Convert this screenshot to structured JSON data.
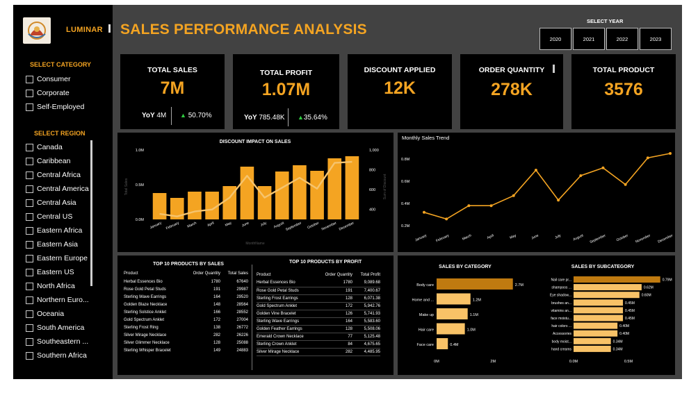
{
  "brand": {
    "name": "LUMINAR"
  },
  "header": {
    "title": "SALES PERFORMANCE ANALYSIS"
  },
  "year_selector": {
    "label": "SELECT YEAR",
    "options": [
      "2020",
      "2021",
      "2022",
      "2023"
    ]
  },
  "sidebar": {
    "category_title": "SELECT CATEGORY",
    "categories": [
      "Consumer",
      "Corporate",
      "Self-Employed"
    ],
    "region_title": "SELECT REGION",
    "regions": [
      "Canada",
      "Caribbean",
      "Central Africa",
      "Central America",
      "Central Asia",
      "Central US",
      "Eastern Africa",
      "Eastern Asia",
      "Eastern Europe",
      "Eastern US",
      "North Africa",
      "Northern Euro...",
      "Oceania",
      "South America",
      "Southeastern ...",
      "Southern Africa"
    ]
  },
  "kpis": {
    "total_sales": {
      "label": "TOTAL SALES",
      "value": "7M",
      "yoy_label": "YoY",
      "yoy_value": "4M",
      "yoy_pct": "50.70%"
    },
    "total_profit": {
      "label": "TOTAL PROFIT",
      "value": "1.07M",
      "yoy_label": "YoY",
      "yoy_value": "785.48K",
      "yoy_pct": "35.64%"
    },
    "discount": {
      "label": "DISCOUNT APPLIED",
      "value": "12K"
    },
    "order_qty": {
      "label": "ORDER QUANTITY",
      "value": "278K"
    },
    "total_product": {
      "label": "TOTAL PRODUCT",
      "value": "3576"
    }
  },
  "chart_data": [
    {
      "type": "bar",
      "title": "DISCOUNT IMPACT ON SALES",
      "xlabel": "MonthName",
      "ylabel": "Total Sales",
      "y2label": "Sum of Discount",
      "categories": [
        "January",
        "February",
        "March",
        "April",
        "May",
        "June",
        "July",
        "August",
        "September",
        "October",
        "November",
        "December"
      ],
      "ylim": [
        0,
        1000000
      ],
      "yticks": [
        "1.0M",
        "0.5M",
        "0.0M"
      ],
      "y2lim": [
        300,
        1000
      ],
      "y2ticks": [
        "1,000",
        "800",
        "600",
        "400"
      ],
      "series": [
        {
          "values": [
            380000,
            310000,
            400000,
            400000,
            480000,
            760000,
            480000,
            690000,
            780000,
            700000,
            880000,
            910000
          ]
        },
        {
          "values": [
            356,
            330,
            380,
            400,
            520,
            740,
            520,
            620,
            720,
            610,
            870,
            880
          ]
        }
      ]
    },
    {
      "type": "line",
      "title": "Monthly Sales Trend",
      "categories": [
        "January",
        "February",
        "March",
        "April",
        "May",
        "June",
        "July",
        "August",
        "September",
        "October",
        "November",
        "December"
      ],
      "ylim": [
        150000,
        900000
      ],
      "yticks": [
        "0.8M",
        "0.6M",
        "0.4M",
        "0.2M"
      ],
      "values": [
        320000,
        260000,
        380000,
        380000,
        470000,
        700000,
        430000,
        650000,
        720000,
        570000,
        810000,
        850000
      ]
    },
    {
      "type": "bar",
      "title": "SALES BY CATEGORY",
      "categories": [
        "Body care",
        "Home and ...",
        "Make up",
        "Hair care",
        "Face care"
      ],
      "values": [
        2.7,
        1.2,
        1.1,
        1.0,
        0.4
      ],
      "value_labels": [
        "2.7M",
        "1.2M",
        "1.1M",
        "1.0M",
        "0.4M"
      ],
      "xticks": [
        "0M",
        "2M"
      ],
      "xlim": [
        0,
        3.2
      ]
    },
    {
      "type": "bar",
      "title": "SALES BY SUBCATEGORY",
      "categories": [
        "Nail care pr...",
        "shampoos ...",
        "Eye shadow...",
        "brushes an...",
        "vitamins an...",
        "face moistu...",
        "hair colors ...",
        "Accessories",
        "body moist...",
        "hand creams"
      ],
      "values": [
        0.79,
        0.62,
        0.6,
        0.45,
        0.45,
        0.45,
        0.4,
        0.4,
        0.34,
        0.34
      ],
      "value_labels": [
        "0.79M",
        "0.62M",
        "0.60M",
        "0.45M",
        "0.45M",
        "0.45M",
        "0.40M",
        "0.40M",
        "0.34M",
        "0.34M"
      ],
      "xticks": [
        "0.0M",
        "0.5M"
      ],
      "xlim": [
        0,
        0.95
      ]
    }
  ],
  "top_sales": {
    "title": "TOP 10 PRODUCTS BY SALES",
    "headers": [
      "Product",
      "Order Quantity",
      "Total Sales"
    ],
    "rows": [
      [
        "Herbal Essences Bio",
        "1780",
        "67640"
      ],
      [
        "Rose Gold Petal Studs",
        "191",
        "29987"
      ],
      [
        "Sterling Wave Earrings",
        "164",
        "29520"
      ],
      [
        "Golden Blaze Necklace",
        "148",
        "28564"
      ],
      [
        "Sterling Solstice Anklet",
        "166",
        "28552"
      ],
      [
        "Gold Spectrum Anklet",
        "172",
        "27004"
      ],
      [
        "Sterling Frost Ring",
        "138",
        "26772"
      ],
      [
        "Silver Mirage Necklace",
        "282",
        "26226"
      ],
      [
        "Silver Glimmer Necklace",
        "128",
        "25088"
      ],
      [
        "Sterling Whisper Bracelet",
        "149",
        "24883"
      ]
    ]
  },
  "top_profit": {
    "title": "TOP 10 PRODUCTS BY PROFIT",
    "headers": [
      "Product",
      "Order Quantity",
      "Total Profit"
    ],
    "rows": [
      [
        "Herbal Essences Bio",
        "1780",
        "9,089.68"
      ],
      [
        "Rose Gold Petal Studs",
        "191",
        "7,400.67"
      ],
      [
        "Sterling Frost Earrings",
        "128",
        "6,071.38"
      ],
      [
        "Gold Spectrum Anklet",
        "172",
        "5,942.76"
      ],
      [
        "Golden Vine Bracelet",
        "126",
        "5,741.93"
      ],
      [
        "Sterling Wave Earrings",
        "164",
        "5,583.60"
      ],
      [
        "Golden Feather Earrings",
        "128",
        "5,508.06"
      ],
      [
        "Emerald Crown Necklace",
        "77",
        "5,125.48"
      ],
      [
        "Sterling Crown Anklet",
        "84",
        "4,675.65"
      ],
      [
        "Silver Mirage Necklace",
        "282",
        "4,485.95"
      ]
    ]
  },
  "colors": {
    "accent": "#f4a422",
    "bar_light": "#f8c267",
    "bar_dark": "#bf7a10",
    "line": "#f6c46e",
    "panel": "#000000",
    "frame": "#424242"
  },
  "icons": {
    "logo": "luminar-crest-logo",
    "trend_up": "triangle-up-icon"
  }
}
